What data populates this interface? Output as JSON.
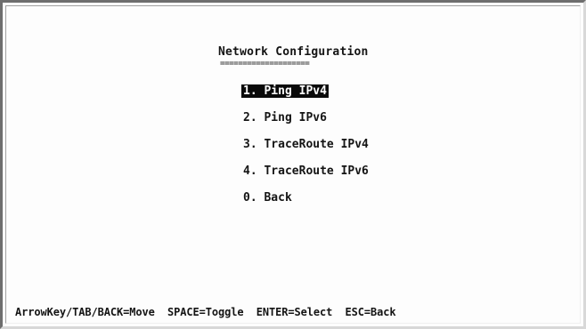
{
  "screen": {
    "title": "Network Configuration",
    "title_underline": "===================="
  },
  "menu": {
    "items": [
      {
        "label": "1. Ping IPv4",
        "selected": true
      },
      {
        "label": "2. Ping IPv6",
        "selected": false
      },
      {
        "label": "3. TraceRoute IPv4",
        "selected": false
      },
      {
        "label": "4. TraceRoute IPv6",
        "selected": false
      },
      {
        "label": "0. Back",
        "selected": false
      }
    ]
  },
  "footer": {
    "help_text": "ArrowKey/TAB/BACK=Move  SPACE=Toggle  ENTER=Select  ESC=Back"
  },
  "colors": {
    "background": "#ffffff",
    "text": "#141414",
    "selection_bg": "#0a0a0a",
    "selection_fg": "#ffffff"
  }
}
